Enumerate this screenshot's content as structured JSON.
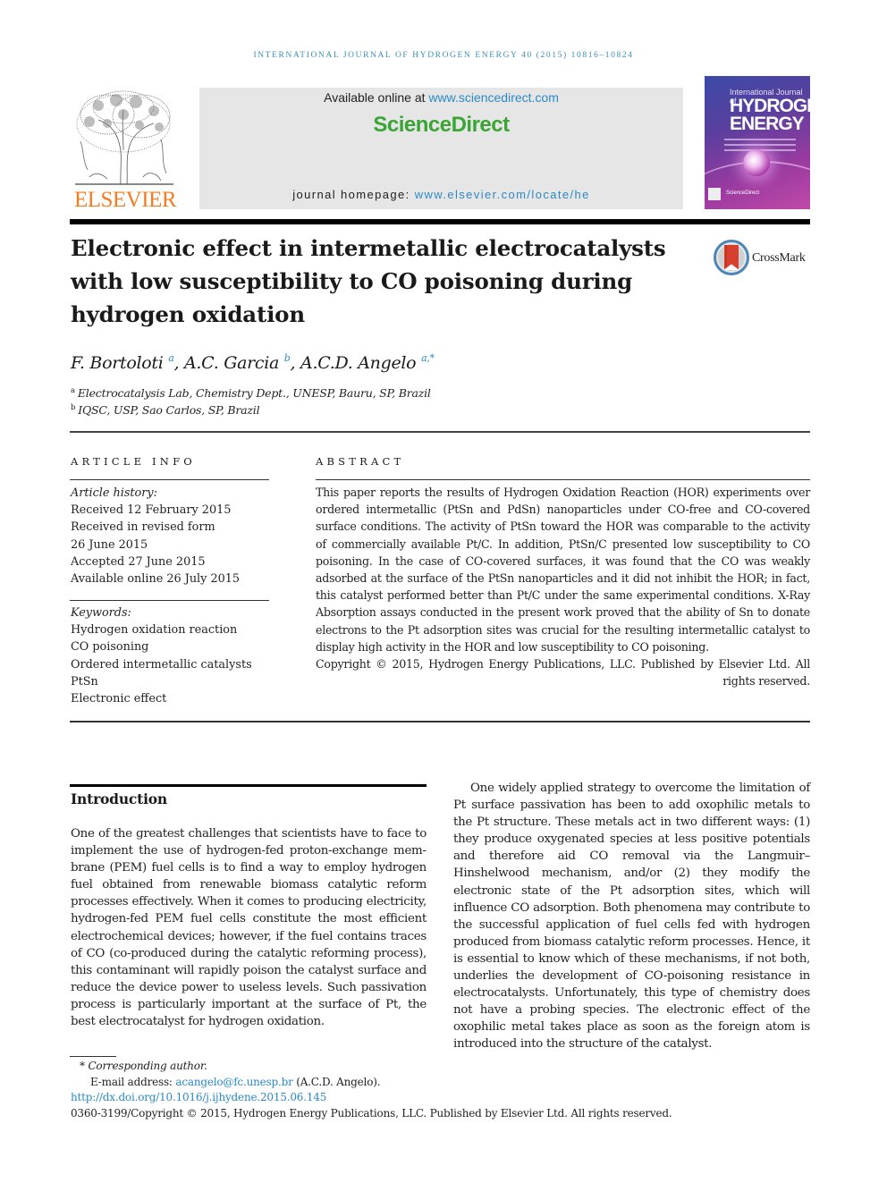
{
  "running_header": "International Journal of Hydrogen Energy 40 (2015) 10816–10824",
  "masthead": {
    "publisher_logo_text": "ELSEVIER",
    "available_online_prefix": "Available online at ",
    "available_online_link": "www.sciencedirect.com",
    "sciencedirect_logo": "ScienceDirect",
    "homepage_prefix": "journal homepage: ",
    "homepage_link": "www.elsevier.com/locate/he",
    "cover": {
      "small_line": "International Journal of",
      "title_line1": "HYDROGEN",
      "title_line2": "ENERGY",
      "footer": "ScienceDirect"
    },
    "colors": {
      "elsevier_orange": "#f47b20",
      "sciencedirect_green": "#3aa535",
      "link_blue": "#2b8ac5",
      "header_blue": "#3a8fb7"
    }
  },
  "article": {
    "title": "Electronic effect in intermetallic electrocatalysts with low susceptibility to CO poisoning during hydrogen oxidation",
    "crossmark_label": "CrossMark",
    "authors": [
      {
        "name": "F. Bortoloti",
        "affil": "a",
        "corresponding": false
      },
      {
        "name": "A.C. Garcia",
        "affil": "b",
        "corresponding": false
      },
      {
        "name": "A.C.D. Angelo",
        "affil": "a,",
        "corresponding": true
      }
    ],
    "corresponding_mark": "*",
    "affiliations": [
      {
        "mark": "a",
        "text": "Electrocatalysis Lab, Chemistry Dept., UNESP, Bauru, SP, Brazil"
      },
      {
        "mark": "b",
        "text": "IQSC, USP, Sao Carlos, SP, Brazil"
      }
    ]
  },
  "article_info": {
    "heading": "ARTICLE INFO",
    "history_label": "Article history:",
    "history": [
      "Received 12 February 2015",
      "Received in revised form",
      "26 June 2015",
      "Accepted 27 June 2015",
      "Available online 26 July 2015"
    ],
    "keywords_label": "Keywords:",
    "keywords": [
      "Hydrogen oxidation reaction",
      "CO poisoning",
      "Ordered intermetallic catalysts",
      "PtSn",
      "Electronic effect"
    ]
  },
  "abstract": {
    "heading": "ABSTRACT",
    "text": "This paper reports the results of Hydrogen Oxidation Reaction (HOR) experiments over ordered intermetallic (PtSn and PdSn) nanoparticles under CO-free and CO-covered surface conditions. The activity of PtSn toward the HOR was comparable to the activity of commercially available Pt/C. In addition, PtSn/C presented low susceptibility to CO poisoning. In the case of CO-covered surfaces, it was found that the CO was weakly adsorbed at the surface of the PtSn nanoparticles and it did not inhibit the HOR; in fact, this catalyst performed better than Pt/C under the same experimental conditions. X-Ray Ab­sorption assays conducted in the present work proved that the ability of Sn to donate electrons to the Pt adsorption sites was crucial for the resulting intermetallic catalyst to display high activity in the HOR and low susceptibility to CO poisoning.",
    "copyright": "Copyright © 2015, Hydrogen Energy Publications, LLC. Published by Elsevier Ltd. All rights reserved."
  },
  "body": {
    "intro_heading": "Introduction",
    "left_column": "One of the greatest challenges that scientists have to face to implement the use of hydrogen-fed proton-exchange mem­brane (PEM) fuel cells is to find a way to employ hydrogen fuel obtained from renewable biomass catalytic reform processes effectively. When it comes to producing electricity, hydrogen-fed PEM fuel cells constitute the most efficient electro­chemical devices; however, if the fuel contains traces of CO (co-produced during the catalytic reforming process), this contaminant will rapidly poison the catalyst surface and reduce the device power to useless levels. Such passivation process is particularly important at the surface of Pt, the best electrocatalyst for hydrogen oxidation.",
    "right_column": "One widely applied strategy to overcome the limitation of Pt surface passivation has been to add oxophilic metals to the Pt structure. These metals act in two different ways: (1) they produce oxygenated species at less positive potentials and therefore aid CO removal via the Langmuir–Hinshelwood mechanism, and/or (2) they modify the electronic state of the Pt adsorption sites, which will influence CO adsorption. Both phenomena may contribute to the successful application of fuel cells fed with hydrogen produced from biomass catalytic reform processes. Hence, it is essential to know which of these mechanisms, if not both, underlies the development of CO-poisoning resistance in electrocatalysts. Unfortunately, this type of chemistry does not have a probing species. The elec­tronic effect of the oxophilic metal takes place as soon as the foreign atom is introduced into the structure of the catalyst."
  },
  "footnotes": {
    "corresponding_mark": "*",
    "corresponding_label": "Corresponding author.",
    "email_prefix": "E-mail address: ",
    "email": "acangelo@fc.unesp.br",
    "email_suffix": " (A.C.D. Angelo).",
    "doi": "http://dx.doi.org/10.1016/j.ijhydene.2015.06.145",
    "issn_copyright": "0360-3199/Copyright © 2015, Hydrogen Energy Publications, LLC. Published by Elsevier Ltd. All rights reserved."
  }
}
